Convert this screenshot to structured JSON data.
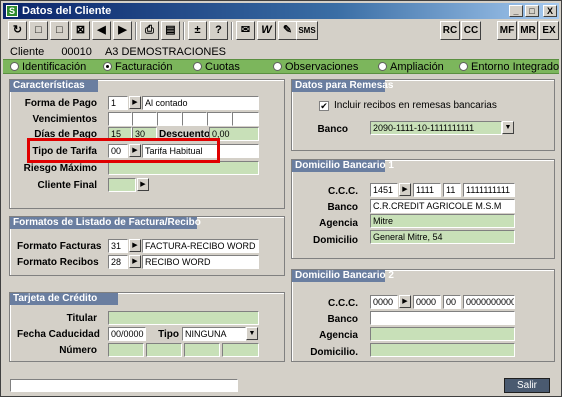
{
  "window": {
    "title": "Datos del Cliente",
    "app_icon": "S",
    "minimize": "_",
    "maximize": "□",
    "close": "X"
  },
  "toolbar": {
    "left_buttons": [
      {
        "name": "refresh-icon",
        "glyph": "↻"
      },
      {
        "name": "new-record-icon",
        "glyph": "□"
      },
      {
        "name": "blank-icon",
        "glyph": "□"
      },
      {
        "name": "delete-icon",
        "glyph": "⊠"
      },
      {
        "name": "prev-icon",
        "glyph": "◀"
      },
      {
        "name": "next-icon",
        "glyph": "▶"
      },
      {
        "name": "print-icon",
        "glyph": "⎙"
      },
      {
        "name": "list-icon",
        "glyph": "▤"
      },
      {
        "name": "plus-minus-icon",
        "glyph": "±"
      },
      {
        "name": "help-icon",
        "glyph": "?"
      },
      {
        "name": "mail-icon",
        "glyph": "✉"
      },
      {
        "name": "word-icon",
        "glyph": "W"
      },
      {
        "name": "notepad-icon",
        "glyph": "✎"
      },
      {
        "name": "sms-icon",
        "glyph": "SMS"
      }
    ],
    "right_buttons": [
      "RC",
      "CC",
      "MF",
      "MR",
      "EX"
    ]
  },
  "client": {
    "label": "Cliente",
    "code": "00010",
    "name": "A3 DEMOSTRACIONES"
  },
  "tabs": [
    "Identificación",
    "Facturación",
    "Cuotas",
    "Observaciones",
    "Ampliación",
    "Entorno Integrado"
  ],
  "active_tab": "Facturación",
  "caracteristicas": {
    "header": "Características",
    "forma_pago_label": "Forma de Pago",
    "forma_pago_code": "1",
    "forma_pago_desc": "Al contado",
    "vencimientos_label": "Vencimientos",
    "dias_pago_label": "Días de Pago",
    "dias_pago_1": "15",
    "dias_pago_2": "30",
    "descuento_label": "Descuento",
    "descuento_value": "0,00",
    "tipo_tarifa_label": "Tipo de Tarifa",
    "tipo_tarifa_code": "00",
    "tipo_tarifa_desc": "Tarifa Habitual",
    "riesgo_label": "Riesgo Máximo",
    "cliente_final_label": "Cliente Final"
  },
  "formatos": {
    "header": "Formatos de Listado de Factura/Recibo",
    "facturas_label": "Formato Facturas",
    "facturas_code": "31",
    "facturas_desc": "FACTURA-RECIBO WORD",
    "recibos_label": "Formato Recibos",
    "recibos_code": "28",
    "recibos_desc": "RECIBO WORD"
  },
  "tarjeta": {
    "header": "Tarjeta de Crédito",
    "titular_label": "Titular",
    "caducidad_label": "Fecha Caducidad",
    "caducidad_value": "00/0000",
    "tipo_label": "Tipo",
    "tipo_value": "NINGUNA",
    "numero_label": "Número"
  },
  "remesas": {
    "header": "Datos para Remesas",
    "incluir_label": "Incluir recibos en remesas bancarias",
    "incluir_checked": "✔",
    "banco_label": "Banco",
    "banco_value": "2090-1111-10-1111111111"
  },
  "domicilio1": {
    "header": "Domicilio Bancario 1",
    "ccc_label": "C.C.C.",
    "ccc_1": "1451",
    "ccc_2": "1111",
    "ccc_3": "11",
    "ccc_4": "1111111111",
    "banco_label": "Banco",
    "banco_value": "C.R.CREDIT AGRICOLE M.S.M",
    "agencia_label": "Agencia",
    "agencia_value": "Mitre",
    "domicilio_label": "Domicilio",
    "domicilio_value": "General Mitre, 54"
  },
  "domicilio2": {
    "header": "Domicilio Bancario 2",
    "ccc_label": "C.C.C.",
    "ccc_1": "0000",
    "ccc_2": "0000",
    "ccc_3": "00",
    "ccc_4": "0000000000",
    "banco_label": "Banco",
    "agencia_label": "Agencia",
    "domicilio_label": "Domicilio."
  },
  "footer": {
    "salir_label": "Salir"
  },
  "colors": {
    "title_bar": "#0a246a",
    "tab_strip": "#7cb65c",
    "group_header": "#6a7ea0",
    "field_bg": "#c8e0b8",
    "highlight": "#e00000"
  }
}
